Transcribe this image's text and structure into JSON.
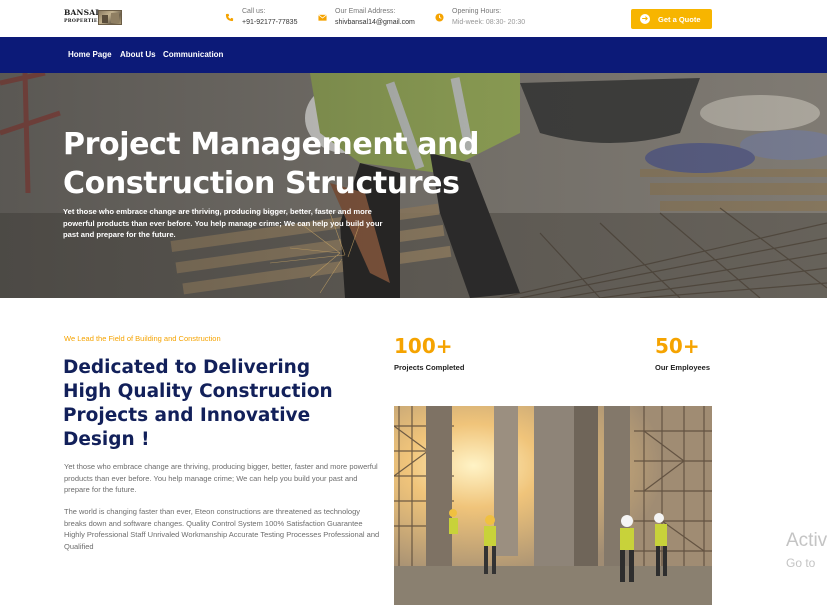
{
  "brand": {
    "logo_line1": "BANSAL",
    "logo_line2": "PROPERTIES"
  },
  "contacts": [
    {
      "icon": "phone-icon",
      "label": "Call us:",
      "value": "+91-92177-77835"
    },
    {
      "icon": "email-icon",
      "label": "Our Email Address:",
      "value": "shivbansal14@gmail.com"
    },
    {
      "icon": "clock-icon",
      "label": "Opening Hours:",
      "value": "Mid-week: 08:30- 20:30"
    }
  ],
  "header": {
    "quote_button": "Get a Quote"
  },
  "nav": {
    "items": [
      "Home Page",
      "About Us",
      "Communication"
    ]
  },
  "hero": {
    "title": "Project Management and Construction Structures",
    "subtitle": "Yet those who embrace change are thriving, producing bigger, better, faster and more powerful products than ever before. You help manage crime; We can help you build your past and prepare for the future."
  },
  "about": {
    "kicker": "We Lead the Field of Building and Construction",
    "title": "Dedicated to Delivering High Quality Construction Projects and Innovative Design !",
    "paragraph1": "Yet those who embrace change are thriving, producing bigger, better, faster and more powerful products than ever before. You help manage crime; We can help you build your past and prepare for the future.",
    "paragraph2": "The world is changing faster than ever, Eteon constructions are threatened as technology breaks down and software changes. Quality Control System 100% Satisfaction Guarantee Highly Professional Staff Unrivaled Workmanship Accurate Testing Processes Professional and Qualified"
  },
  "stats": [
    {
      "value": "100+",
      "label": "Projects Completed"
    },
    {
      "value": "50+",
      "label": "Our Employees"
    }
  ],
  "watermark": {
    "line1": "Activ",
    "line2": "Go to"
  },
  "colors": {
    "accent": "#f5a300",
    "nav_bg": "#0c1a78",
    "heading": "#12205a"
  }
}
